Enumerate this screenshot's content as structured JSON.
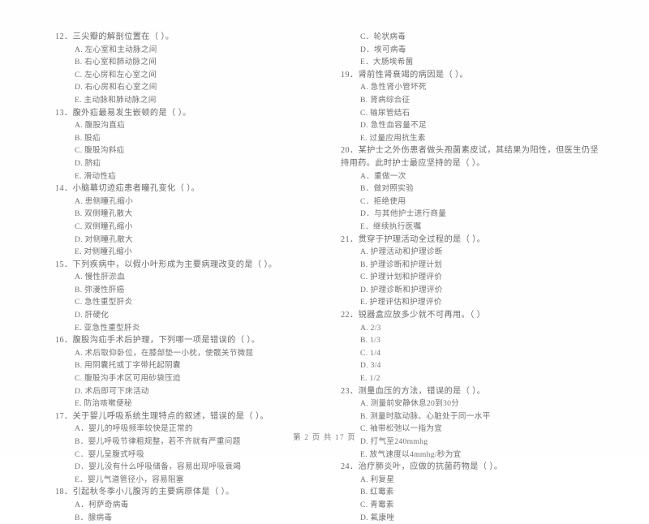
{
  "document": {
    "page_footer": "第 2 页 共 17 页",
    "footer_current_page": "2",
    "footer_total_pages": "17"
  },
  "columns": {
    "left": [
      {
        "number": "12",
        "stem": "12．三尖瓣的解剖位置在（      ）。",
        "options": [
          "A. 左心室和主动脉之间",
          "B. 右心室和肺动脉之间",
          "C. 左心房和左心室之间",
          "D. 右心房和右心室之间",
          "E. 主动脉和肺动脉之间"
        ]
      },
      {
        "number": "13",
        "stem": "13．腹外疝最易发生嵌顿的是（      ）。",
        "options": [
          "A. 腹股沟直疝",
          "B. 股疝",
          "C. 腹股沟斜疝",
          "D. 脐疝",
          "E. 滑动性疝"
        ]
      },
      {
        "number": "14",
        "stem": "14．小脑幕切迹疝患者瞳孔变化（      ）。",
        "options": [
          "A. 患侧瞳孔缩小",
          "B. 双侧瞳孔散大",
          "C. 双侧瞳孔缩小",
          "D. 对侧瞳孔散大",
          "E. 对侧瞳孔缩小"
        ]
      },
      {
        "number": "15",
        "stem": "15．下列疾病中，以假小叶形成为主要病理改变的是（      ）。",
        "options": [
          "A. 慢性肝淤血",
          "B. 弥漫性肝癌",
          "C. 急性重型肝炎",
          "D. 肝硬化",
          "E. 亚急性重型肝炎"
        ]
      },
      {
        "number": "16",
        "stem": "16．腹股沟疝手术后护理，下列哪一项是错误的（      ）。",
        "options": [
          "A. 术后取仰卧位，在膝部垫一小枕，使髋关节微屈",
          "B. 用阴囊托或丁字带托起阴囊",
          "C. 腹股沟手术区可用砂袋压迫",
          "D. 术后即可下床活动",
          "E. 防治咳嗽便秘"
        ]
      },
      {
        "number": "17",
        "stem": "17．关于婴儿呼吸系统生理特点的叙述，错误的是（      ）。",
        "options": [
          "A．婴儿的呼吸频率较快是正常的",
          "B．婴儿呼吸节律粗规整，若不齐就有严重问题",
          "C．婴儿呈腹式呼吸",
          "D．婴儿没有什么呼吸储备，容易出现呼吸衰竭",
          "E．婴儿气道管径小，容易阻塞"
        ]
      },
      {
        "number": "18",
        "stem": "18．引起秋冬季小儿腹泻的主要病原体是（      ）。",
        "options": [
          "A．柯萨奇病毒",
          "B．腺病毒"
        ]
      }
    ],
    "right": [
      {
        "number": "18-cont",
        "stem": "",
        "options": [
          "C．轮状病毒",
          "D．埃可病毒",
          "E．大肠埃希菌"
        ]
      },
      {
        "number": "19",
        "stem": "19．肾前性肾衰竭的病因是（      ）。",
        "options": [
          "A. 急性肾小管坏死",
          "B. 肾病综合征",
          "C. 输尿管结石",
          "D. 急性血容量不足",
          "E. 过量应用抗生素"
        ]
      },
      {
        "number": "20",
        "stem": "20．某护士之外伤患者做头孢菌素皮试，其结果为阳性，但医生仍坚持用药。此时护士最应坚持的是（      ）。",
        "options": [
          "A．重做一次",
          "B．做对照实验",
          "C．拒绝使用",
          "D．与其他护士进行商量",
          "E．继续执行医嘱"
        ]
      },
      {
        "number": "21",
        "stem": "21．贯穿于护理活动全过程的是（      ）。",
        "options": [
          "A. 护理活动和护理诊断",
          "B. 护理诊断和护理计划",
          "C. 护理计划和护理评价",
          "D. 护理诊断和护理评价",
          "E. 护理评估和护理评价"
        ]
      },
      {
        "number": "22",
        "stem": "22．锐器盒应放多少就不可再用。（      ）",
        "options": [
          "A. 2/3",
          "B. 1/3",
          "C. 1/4",
          "D. 3/4",
          "E. 1/2"
        ]
      },
      {
        "number": "23",
        "stem": "23．测量血压的方法，错误的是（      ）。",
        "options": [
          "A. 测量前安静休息20到30分",
          "B. 测量时肱动脉、心脏处于同一水平",
          "C. 袖带松弛以一指为宜",
          "D. 打气至240mmhg",
          "E. 放气速度以4mmhg/秒为宜"
        ]
      },
      {
        "number": "24",
        "stem": "24．治疗肺炎叶，应做的抗菌药物是（      ）。",
        "options": [
          "A. 利复星",
          "B. 红霉素",
          "C. 青霉素",
          "D. 氟康唑"
        ]
      }
    ]
  }
}
